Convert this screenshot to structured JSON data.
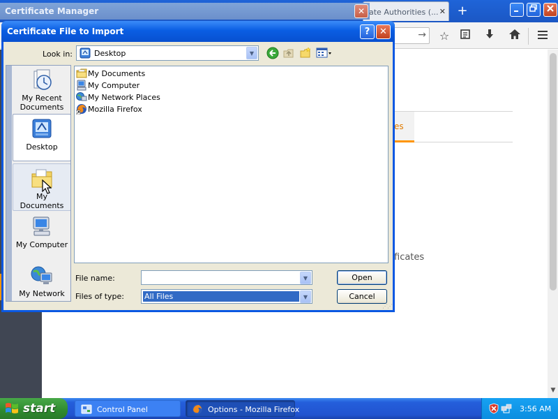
{
  "firefox": {
    "tab_label": "ate Authorities (...",
    "tab_close": "✕",
    "new_tab": "+",
    "active_tab_partial": "es",
    "content_partial": "ficates"
  },
  "cert_manager": {
    "title": "Certificate Manager",
    "close": "✕"
  },
  "dialog": {
    "title": "Certificate File to Import",
    "help": "?",
    "close": "✕",
    "look_in_label": "Look in:",
    "look_in_value": "Desktop",
    "places": [
      {
        "label": "My Recent Documents",
        "icon": "recent-documents-icon"
      },
      {
        "label": "Desktop",
        "icon": "desktop-icon"
      },
      {
        "label": "My Documents",
        "icon": "my-documents-icon"
      },
      {
        "label": "My Computer",
        "icon": "my-computer-icon"
      },
      {
        "label": "My Network",
        "icon": "my-network-icon"
      }
    ],
    "files": [
      {
        "name": "My Documents",
        "icon": "folder-icon"
      },
      {
        "name": "My Computer",
        "icon": "computer-icon"
      },
      {
        "name": "My Network Places",
        "icon": "network-places-icon"
      },
      {
        "name": "Mozilla Firefox",
        "icon": "firefox-shortcut-icon"
      }
    ],
    "file_name_label": "File name:",
    "file_name_value": "",
    "file_type_label": "Files of type:",
    "file_type_value": "All Files",
    "open_button": "Open",
    "cancel_button": "Cancel"
  },
  "taskbar": {
    "start_label": "start",
    "tasks": [
      {
        "label": "Control Panel",
        "active": false
      },
      {
        "label": "Options - Mozilla Firefox",
        "active": true
      }
    ],
    "clock": "3:56 AM"
  },
  "colors": {
    "xp_blue": "#0a5ee3",
    "dialog_face": "#ece9d8",
    "selection": "#316ac5",
    "firefox_accent": "#ff9500"
  }
}
